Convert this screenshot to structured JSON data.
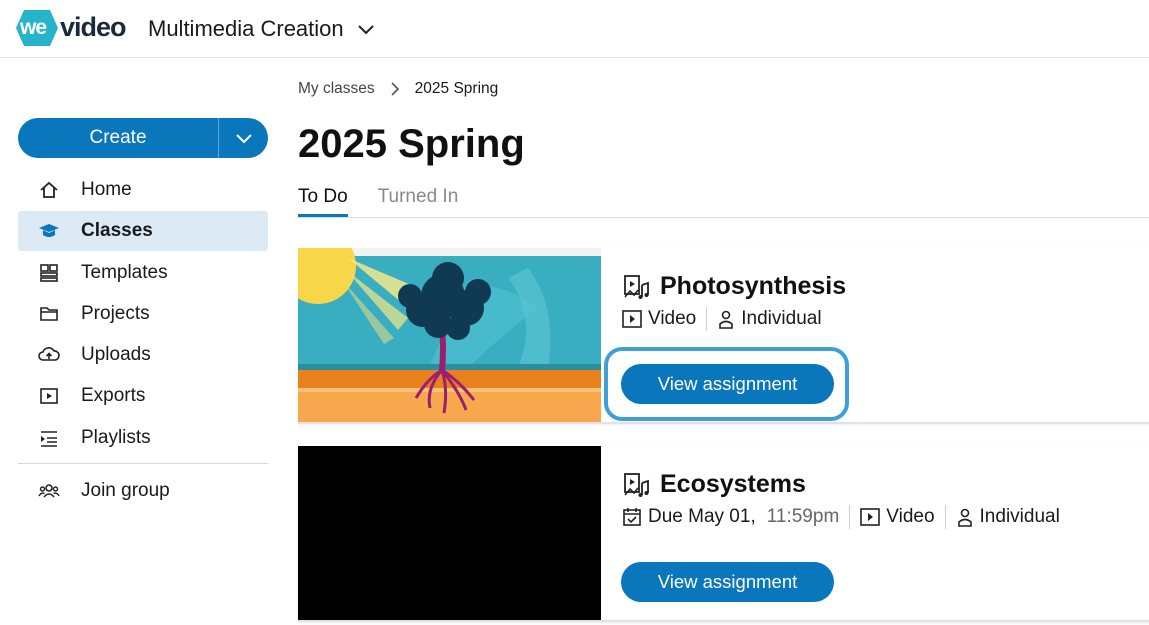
{
  "app": {
    "logo_we": "we",
    "logo_video": "video",
    "workspace_name": "Multimedia Creation",
    "brand_color": "#0a76bc"
  },
  "sidebar": {
    "create_label": "Create",
    "items": [
      {
        "label": "Home",
        "icon": "home-icon"
      },
      {
        "label": "Classes",
        "icon": "graduation-cap-icon",
        "active": true
      },
      {
        "label": "Templates",
        "icon": "templates-icon"
      },
      {
        "label": "Projects",
        "icon": "folder-icon"
      },
      {
        "label": "Uploads",
        "icon": "cloud-upload-icon"
      },
      {
        "label": "Exports",
        "icon": "export-play-icon"
      },
      {
        "label": "Playlists",
        "icon": "playlist-icon"
      }
    ],
    "join_group_label": "Join group"
  },
  "breadcrumb": {
    "parent": "My classes",
    "current": "2025 Spring"
  },
  "page": {
    "title": "2025 Spring",
    "tabs": [
      {
        "label": "To Do",
        "active": true
      },
      {
        "label": "Turned In",
        "active": false
      }
    ]
  },
  "assignments": [
    {
      "title": "Photosynthesis",
      "type": "Video",
      "mode": "Individual",
      "button": "View assignment"
    },
    {
      "title": "Ecosystems",
      "due_label": "Due May 01,",
      "due_time": "11:59pm",
      "type": "Video",
      "mode": "Individual",
      "button": "View assignment"
    }
  ]
}
